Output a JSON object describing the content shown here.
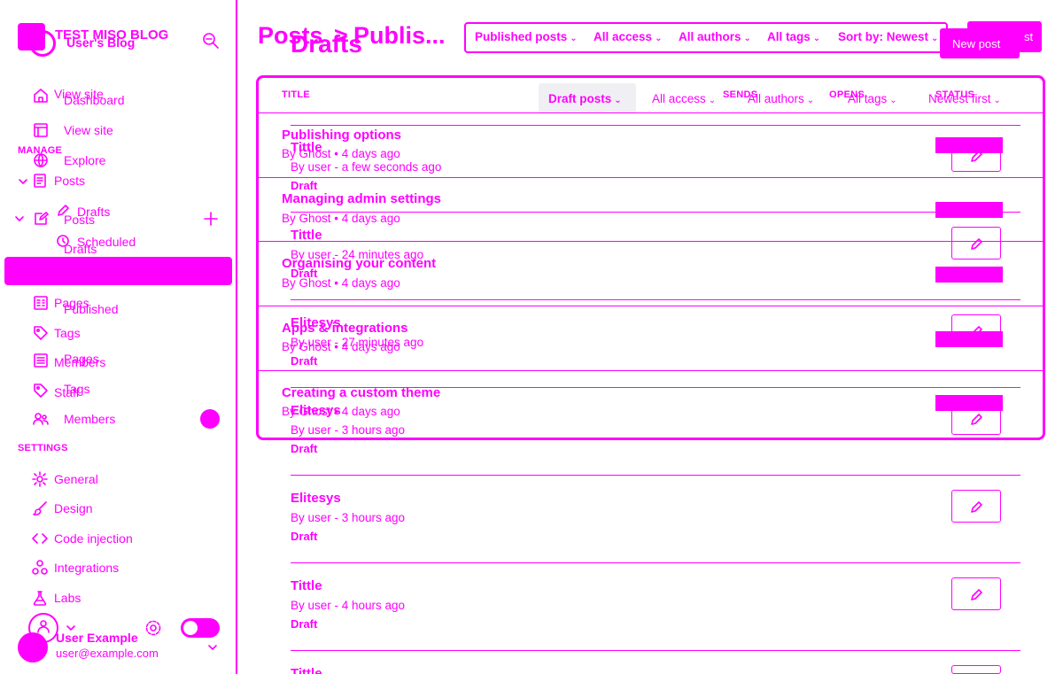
{
  "sidebar": {
    "blog_name": "TEST MISO BLOG",
    "blog_subtitle": "User's Blog",
    "top_items": [
      {
        "label": "View site",
        "icon": "home-icon"
      },
      {
        "label": "Dashboard",
        "icon": "home-icon"
      },
      {
        "label": "View site",
        "icon": "browser-icon"
      },
      {
        "label": "Explore",
        "icon": "globe-icon"
      }
    ],
    "manage_heading": "MANAGE",
    "posts_label": "Posts",
    "posts_label_2": "Posts",
    "drafts_label": "Drafts",
    "drafts_label_2": "Drafts",
    "scheduled_label": "Scheduled",
    "published_label": "Published",
    "pages_label": "Pages",
    "pages_label_2": "Pages",
    "tags_label": "Tags",
    "tags_label_2": "Tags",
    "members_label": "Members",
    "members_label_2": "Members",
    "staff_label": "Staff",
    "settings_heading": "SETTINGS",
    "settings_items": [
      {
        "label": "General",
        "icon": "gear-icon"
      },
      {
        "label": "Design",
        "icon": "brush-icon"
      },
      {
        "label": "Code injection",
        "icon": "code-icon"
      },
      {
        "label": "Integrations",
        "icon": "integrations-icon"
      },
      {
        "label": "Labs",
        "icon": "flask-icon"
      }
    ],
    "user_name": "User Example",
    "user_email": "user@example.com"
  },
  "header": {
    "title_back": "Posts",
    "title_sep": ">",
    "title_current": "Publis...",
    "title_drafts": "Drafts",
    "new_post_button": "New post",
    "new_post_button_2": "st",
    "filters": [
      {
        "label": "Published posts"
      },
      {
        "label": "All access"
      },
      {
        "label": "All authors"
      },
      {
        "label": "All tags"
      },
      {
        "label": "Sort by: Newest"
      }
    ]
  },
  "table": {
    "col_title": "TITLE",
    "col_sends": "SENDS",
    "col_opens": "OPENS",
    "col_status": "STATUS",
    "draft_filters": [
      {
        "label": "Draft posts"
      },
      {
        "label": "All access"
      },
      {
        "label": "All authors"
      },
      {
        "label": "All tags"
      },
      {
        "label": "Newest first"
      }
    ],
    "published_rows": [
      {
        "title": "Publishing options",
        "meta": "By Ghost • 4 days ago"
      },
      {
        "title": "Managing admin settings",
        "meta": "By Ghost • 4 days ago"
      },
      {
        "title": "Organising your content",
        "meta": "By Ghost • 4 days ago"
      },
      {
        "title": "Apps & integrations",
        "meta": "By Ghost • 4 days ago"
      },
      {
        "title": "Creating a custom theme",
        "meta": "By Ghost • 4 days ago"
      }
    ],
    "draft_rows": [
      {
        "title": "Tittle",
        "meta": "By user - a few seconds ago",
        "status": "Draft"
      },
      {
        "title": "Tittle",
        "meta": "By user - 24 minutes ago",
        "status": "Draft"
      },
      {
        "title": "Elitesys",
        "meta": "By user - 27 minutes ago",
        "status": "Draft"
      },
      {
        "title": "Elitesys",
        "meta": "By user - 3 hours ago",
        "status": "Draft"
      },
      {
        "title": "Elitesys",
        "meta": "By user - 3 hours ago",
        "status": "Draft"
      },
      {
        "title": "Tittle",
        "meta": "By user - 4 hours ago",
        "status": "Draft"
      },
      {
        "title": "Tittle",
        "meta": "",
        "status": ""
      }
    ]
  },
  "colors": {
    "accent": "#ff00ff",
    "background": "#ffffff"
  }
}
